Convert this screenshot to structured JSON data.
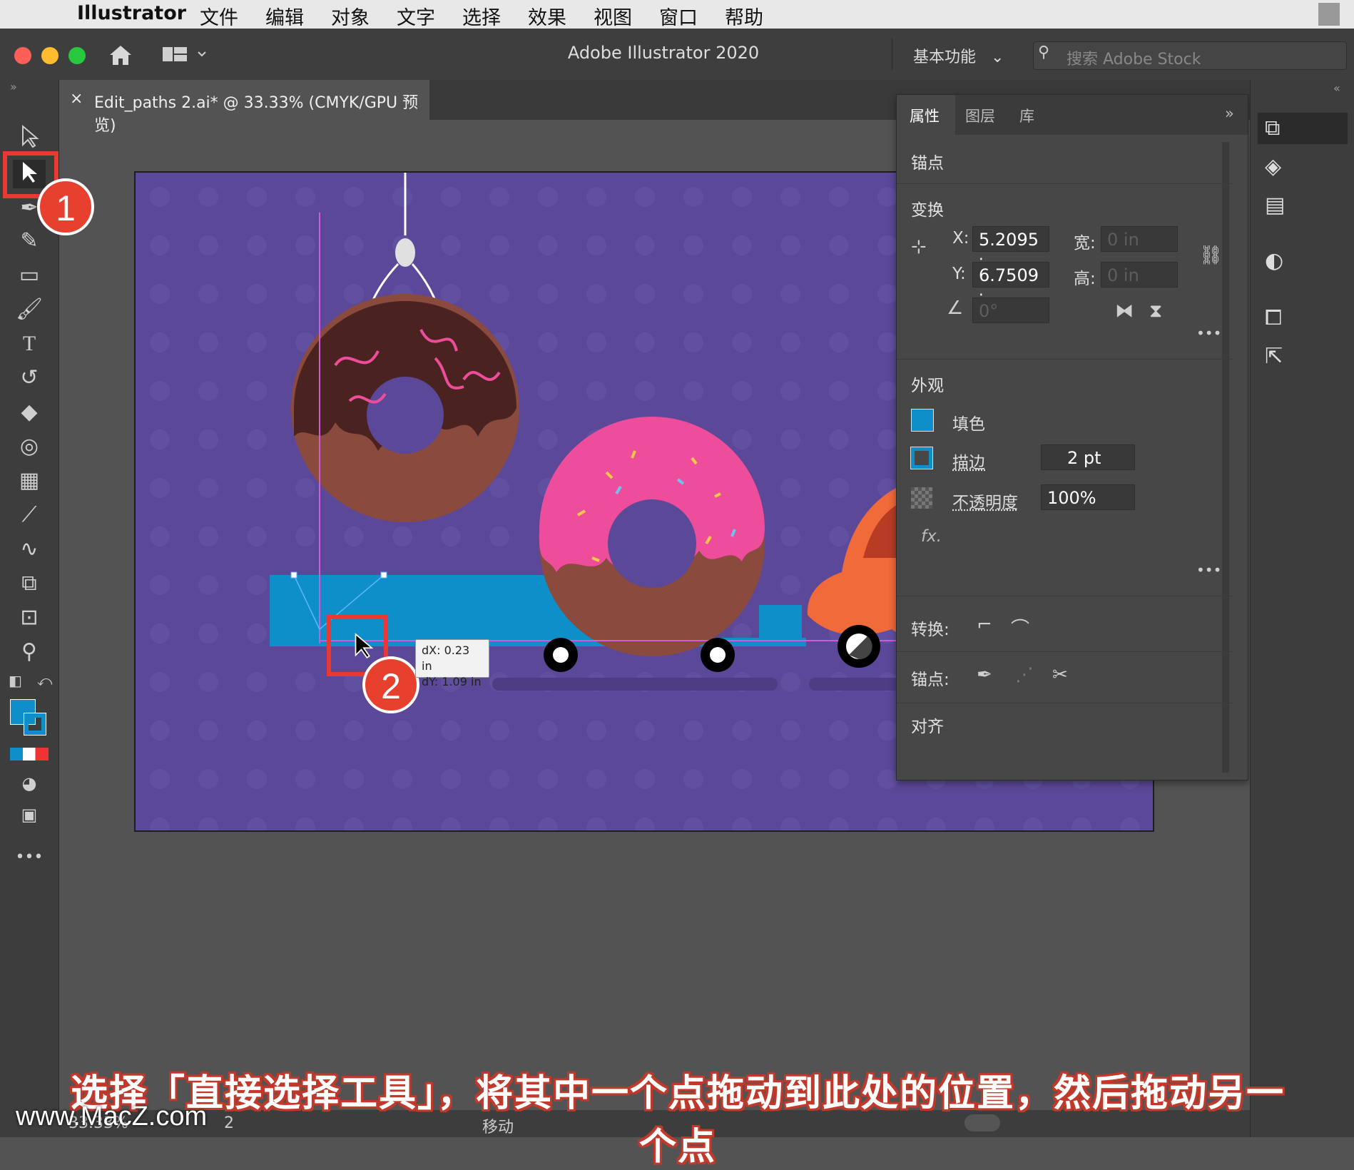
{
  "menubar": {
    "app": "Illustrator",
    "items": [
      "文件",
      "编辑",
      "对象",
      "文字",
      "选择",
      "效果",
      "视图",
      "窗口",
      "帮助"
    ]
  },
  "window": {
    "title": "Adobe Illustrator 2020",
    "workspace": "基本功能",
    "search_placeholder": "搜索 Adobe Stock"
  },
  "document_tab": {
    "label": "Edit_paths 2.ai* @ 33.33% (CMYK/GPU 预览)"
  },
  "tooltip": {
    "dx": "dX: 0.23 in",
    "dy": "dY: 1.09 in"
  },
  "panel": {
    "tabs": [
      "属性",
      "图层",
      "库"
    ],
    "selection": "锚点",
    "transform": {
      "title": "变换",
      "x_label": "X:",
      "x_value": "5.2095 i",
      "y_label": "Y:",
      "y_value": "6.7509 i",
      "w_label": "宽:",
      "w_value": "0 in",
      "h_label": "高:",
      "h_value": "0 in",
      "angle_value": "0°"
    },
    "appearance": {
      "title": "外观",
      "fill_label": "填色",
      "stroke_label": "描边",
      "stroke_value": "2 pt",
      "opacity_label": "不透明度",
      "opacity_value": "100%",
      "fx": "fx."
    },
    "convert_label": "转换:",
    "anchor_label": "锚点:",
    "align_title": "对齐"
  },
  "status": {
    "zoom": "33.33%",
    "page": "2",
    "mode": "移动"
  },
  "annotations": {
    "badge1": "1",
    "badge2": "2",
    "caption": "选择「直接选择工具」，将其中一个点拖动到此处的位置，然后拖动另一个点",
    "watermark": "www.MacZ.com"
  },
  "colors": {
    "artboard": "#5b4898",
    "truck": "#0f8fc9",
    "accent_red": "#e83a32",
    "donut_pink": "#ee4d9b",
    "chocolate": "#4a2320",
    "dough": "#8a4a3e",
    "car": "#f06a3a"
  }
}
